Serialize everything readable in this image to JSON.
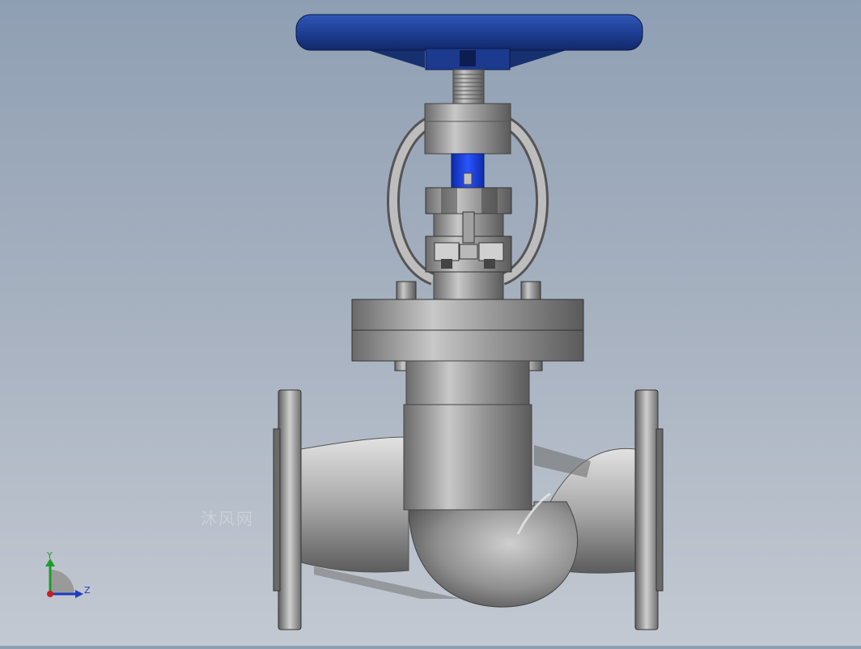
{
  "viewport": {
    "background_top": "#8f9fb3",
    "background_bottom": "#c3c9d2"
  },
  "model": {
    "handwheel_color": "#1e3f94",
    "stem_sleeve_color": "#1b3fd0",
    "metal_color": "#9a9a9a"
  },
  "triad": {
    "y_label": "Y",
    "z_label": "Z",
    "y_color": "#1c9c2a",
    "z_color": "#1f3bbf",
    "x_color": "#c8201e"
  },
  "watermark": {
    "text": "沐风网"
  }
}
